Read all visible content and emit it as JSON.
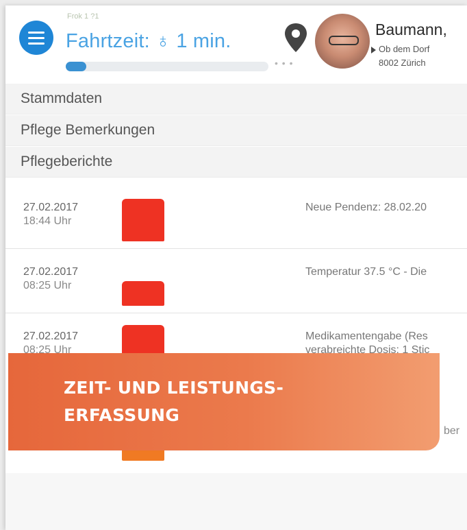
{
  "header": {
    "small_label": "Frok 1 ?1",
    "drive_time": "Fahrtzeit: ♁ 1 min.",
    "progress": 0.1,
    "more_dots": "• • •",
    "patient": {
      "name": "Baumann,",
      "street": "Ob dem Dorf",
      "city": "8002 Zürich"
    }
  },
  "sections": [
    {
      "label": "Stammdaten"
    },
    {
      "label": "Pflege Bemerkungen"
    },
    {
      "label": "Pflegeberichte"
    }
  ],
  "entries": [
    {
      "date": "27.02.2017",
      "time": "18:44 Uhr",
      "line1": "Neue Pendenz: 28.02.20",
      "line2": "",
      "color": "#ee3223"
    },
    {
      "date": "27.02.2017",
      "time": "08:25 Uhr",
      "line1": "Temperatur 37.5 °C - Die",
      "line2": "",
      "color": "#ee3223"
    },
    {
      "date": "27.02.2017",
      "time": "08:25 Uhr",
      "line1": "Medikamentengabe (Res",
      "line2": "verabreichte Dosis: 1 Stic",
      "color": "#ee3223"
    }
  ],
  "hidden_row": {
    "desc_tail": "ber"
  },
  "banner": {
    "line1": "ZEIT- UND LEISTUNGS-",
    "line2": "ERFASSUNG"
  },
  "colors": {
    "accent_blue": "#1f86d6",
    "time_text": "#4aa3e3",
    "status_red": "#ee3223",
    "status_orange": "#f07a23",
    "banner_orange": "#e6673b"
  },
  "icons": [
    "menu-icon",
    "map-pin-icon",
    "patient-avatar",
    "chevron-right-icon"
  ]
}
